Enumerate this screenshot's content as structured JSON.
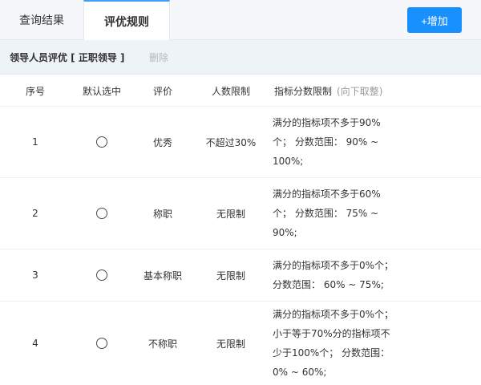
{
  "tabs": {
    "results_label": "查询结果",
    "rules_label": "评优规则"
  },
  "toolbar": {
    "add_label": "+增加"
  },
  "group": {
    "title": "领导人员评优 [ 正职领导 ]",
    "delete_label": "删除"
  },
  "table": {
    "headers": {
      "seq": "序号",
      "default_selected": "默认选中",
      "evaluation": "评价",
      "headcount_limit": "人数限制",
      "score_limit": "指标分数限制",
      "score_limit_note": "(向下取整)"
    },
    "rows": [
      {
        "seq": "1",
        "evaluation": "优秀",
        "headcount_limit": "不超过30%",
        "score_limit": "满分的指标项不多于90%个； 分数范围： 90% ~ 100%;"
      },
      {
        "seq": "2",
        "evaluation": "称职",
        "headcount_limit": "无限制",
        "score_limit": "满分的指标项不多于60%个； 分数范围： 75% ~ 90%;"
      },
      {
        "seq": "3",
        "evaluation": "基本称职",
        "headcount_limit": "无限制",
        "score_limit": "满分的指标项不多于0%个； 分数范围： 60% ~ 75%;"
      },
      {
        "seq": "4",
        "evaluation": "不称职",
        "headcount_limit": "无限制",
        "score_limit": "满分的指标项不多于0%个； 小于等于70%分的指标项不少于100%个； 分数范围： 0% ~ 60%;"
      }
    ]
  },
  "colors": {
    "accent": "#409eff",
    "button": "#1890ff",
    "group_bg": "#eef3f8"
  }
}
